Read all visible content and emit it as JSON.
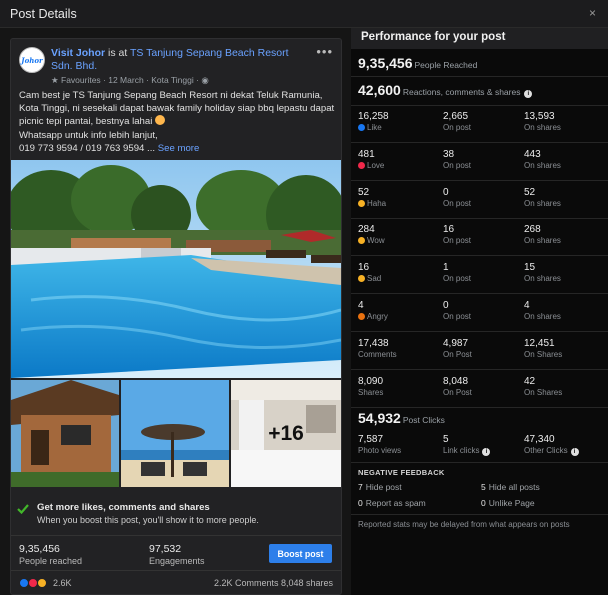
{
  "window": {
    "title": "Post Details",
    "close_label": "×"
  },
  "post": {
    "avatar_text": "Johor",
    "page_name": "Visit Johor",
    "verb": " is at ",
    "place": "TS Tanjung Sepang Beach Resort Sdn. Bhd.",
    "meta": "Favourites · 12 March · Kota Tinggi ·",
    "more_label": "•••",
    "caption_text": "Cam best je TS Tanjung Sepang Beach Resort ni dekat Teluk Ramunia, Kota Tinggi, ni sesekali dapat bawak family holiday siap bbq lepastu dapat picnic tepi pantai, bestnya lahai ",
    "caption_line2": "Whatsapp untuk info lebih lanjut,",
    "caption_line3": "019 773 9594 / 019 763 9594 ...",
    "see_more": "See more",
    "photo_more": "+16",
    "boost_title": "Get more likes, comments and shares",
    "boost_sub": "When you boost this post, you'll show it to more people.",
    "people_reached_num": "9,35,456",
    "people_reached_lab": "People reached",
    "engagements_num": "97,532",
    "engagements_lab": "Engagements",
    "boost_button": "Boost post",
    "reactions_count": "2.6K",
    "comments_shares": "2.2K Comments  8,048 shares"
  },
  "performance": {
    "title": "Performance for your post",
    "reach_num": "9,35,456",
    "reach_lab": "People Reached",
    "engage_num": "42,600",
    "engage_lab": "Reactions, comments & shares",
    "rows": [
      {
        "total": "16,258",
        "label": "Like",
        "icon": "like-icon",
        "color": "#1877f2",
        "on_post": "2,665",
        "on_post_lab": "On post",
        "on_shares": "13,593",
        "on_shares_lab": "On shares"
      },
      {
        "total": "481",
        "label": "Love",
        "icon": "love-icon",
        "color": "#f0284a",
        "on_post": "38",
        "on_post_lab": "On post",
        "on_shares": "443",
        "on_shares_lab": "On shares"
      },
      {
        "total": "52",
        "label": "Haha",
        "icon": "haha-icon",
        "color": "#f7b125",
        "on_post": "0",
        "on_post_lab": "On post",
        "on_shares": "52",
        "on_shares_lab": "On shares"
      },
      {
        "total": "284",
        "label": "Wow",
        "icon": "wow-icon",
        "color": "#f7b125",
        "on_post": "16",
        "on_post_lab": "On post",
        "on_shares": "268",
        "on_shares_lab": "On shares"
      },
      {
        "total": "16",
        "label": "Sad",
        "icon": "sad-icon",
        "color": "#f7b125",
        "on_post": "1",
        "on_post_lab": "On post",
        "on_shares": "15",
        "on_shares_lab": "On shares"
      },
      {
        "total": "4",
        "label": "Angry",
        "icon": "angry-icon",
        "color": "#e9710f",
        "on_post": "0",
        "on_post_lab": "On post",
        "on_shares": "4",
        "on_shares_lab": "On shares"
      },
      {
        "total": "17,438",
        "label": "Comments",
        "icon": "",
        "color": "",
        "on_post": "4,987",
        "on_post_lab": "On Post",
        "on_shares": "12,451",
        "on_shares_lab": "On Shares"
      },
      {
        "total": "8,090",
        "label": "Shares",
        "icon": "",
        "color": "",
        "on_post": "8,048",
        "on_post_lab": "On Post",
        "on_shares": "42",
        "on_shares_lab": "On Shares"
      }
    ],
    "clicks_num": "54,932",
    "clicks_lab": "Post Clicks",
    "clicks": [
      {
        "num": "7,587",
        "lab": "Photo views"
      },
      {
        "num": "5",
        "lab": "Link clicks"
      },
      {
        "num": "47,340",
        "lab": "Other Clicks"
      }
    ],
    "negative_title": "NEGATIVE FEEDBACK",
    "negative": [
      {
        "num": "7",
        "lab": "Hide post"
      },
      {
        "num": "5",
        "lab": "Hide all posts"
      },
      {
        "num": "0",
        "lab": "Report as spam"
      },
      {
        "num": "0",
        "lab": "Unlike Page"
      }
    ],
    "footnote": "Reported stats may be delayed from what appears on posts"
  },
  "colors": {
    "accent": "#2d7fea",
    "link": "#6aa2ff",
    "panel": "#0a0a0a"
  }
}
